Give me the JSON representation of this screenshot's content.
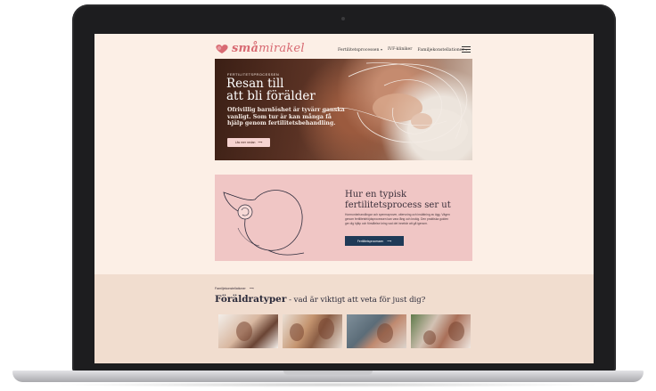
{
  "colors": {
    "screen_background": "#fcefe6",
    "logo": "#d86a72",
    "process_card": "#f0c6c5",
    "primary_button": "#1f3a57",
    "section_background": "#f1ddcf"
  },
  "header": {
    "logo_prefix": "små",
    "logo_suffix": "mirakel",
    "nav": [
      {
        "label": "Fertilitetsprocessen",
        "dropdown": true
      },
      {
        "label": "IVF-kliniker",
        "dropdown": false
      },
      {
        "label": "Familjekonstellationer",
        "dropdown": true
      }
    ],
    "menu_icon": "hamburger-icon"
  },
  "hero": {
    "eyebrow": "FERTILITETSPROCESSEN",
    "title_line1": "Resan till",
    "title_line2": "att bli förälder",
    "text": "Ofrivillig barnlöshet är tyvärr ganska vanligt. Som tur är kan många få hjälp genom fertilitetsbehandling.",
    "button_label": "Läs mer nedan",
    "button_icon": "arrow-right-icon"
  },
  "process": {
    "title": "Hur en typisk fertilitetsprocess ser ut",
    "text": "Hormonbehandlingar och spermaprover, uttervning och insättning av ägg. Vägen genom fertilitetsfröjdsprocessen kan vara lång och krokig. Den praktiska guiden ger dig hjälp och förståelse kring vad det innebär att gå igenom.",
    "button_label": "Fertilitetsprocessen",
    "button_icon": "arrow-right-icon"
  },
  "parents": {
    "eyebrow": "Familjekonstellationer",
    "eyebrow_icon": "arrow-right-icon",
    "heading_strong": "Föräldratyper",
    "heading_rest": " - vad är viktigt att veta för just dig?",
    "thumbnails": [
      "photo-couple",
      "photo-parents-baby",
      "photo-mother-baby",
      "photo-family-home"
    ]
  }
}
